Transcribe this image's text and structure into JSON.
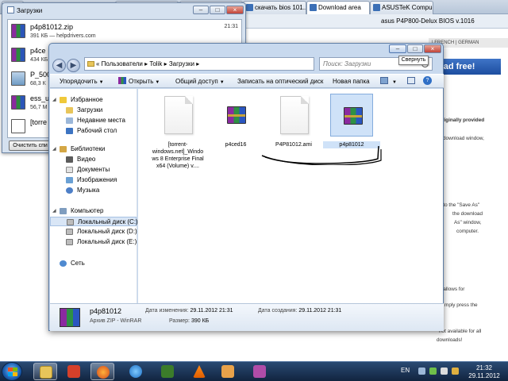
{
  "browser": {
    "tabs": [
      {
        "label": "Загрузки"
      },
      {
        "label": ""
      },
      {
        "label": ""
      },
      {
        "label": "скачать bios 101..."
      },
      {
        "label": "Download area"
      },
      {
        "label": "ASUSTeK Compu..."
      }
    ],
    "address": "asus P4P800-Delux BIOS v.1016",
    "site": {
      "strip": "| FRENCH | GERMAN",
      "banner": "oad free!",
      "lines": [
        {
          "text": "originally provided",
          "bold": true
        },
        {
          "text": "download window,",
          "bold": false
        },
        {
          "text": "n to the \"Save As\"",
          "bold": false
        },
        {
          "text": "the download",
          "bold": false
        },
        {
          "text": "As\" window,",
          "bold": false
        },
        {
          "text": "computer.",
          "bold": false
        },
        {
          "text": "n allows for",
          "bold": false
        },
        {
          "text": "mply press the",
          "bold": false
        },
        {
          "text": "not available for all",
          "bold": false
        },
        {
          "text": "downloads!",
          "bold": false
        }
      ]
    }
  },
  "downloads_window": {
    "title": "Загрузки",
    "items": [
      {
        "name": "p4p81012.zip",
        "size": "391 КБ — helpdrivers.com",
        "time": "21:31",
        "icon": "rar-icon"
      },
      {
        "name": "p4ce",
        "size": "434 КБ",
        "time": "",
        "icon": "rar-icon"
      },
      {
        "name": "P_500",
        "size": "68,3 К",
        "time": "",
        "icon": "image-icon"
      },
      {
        "name": "ess_u",
        "size": "56,7 М",
        "time": "",
        "icon": "rar-icon"
      },
      {
        "name": "[torre",
        "size": "",
        "time": "",
        "icon": "document-icon"
      }
    ],
    "clear_button": "Очистить спи"
  },
  "explorer": {
    "breadcrumb": "« Пользователи ▸ Tolik ▸ Загрузки ▸",
    "search_placeholder": "Поиск: Загрузки",
    "toolbar": {
      "organize": "Упорядочить",
      "open": "Открыть",
      "share": "Общий доступ",
      "burn": "Записать на оптический диск",
      "new_folder": "Новая папка"
    },
    "nav": {
      "favorites": "Избранное",
      "downloads": "Загрузки",
      "recent": "Недавние места",
      "desktop": "Рабочий стол",
      "libraries": "Библиотеки",
      "video": "Видео",
      "documents": "Документы",
      "images": "Изображения",
      "music": "Музыка",
      "computer": "Компьютер",
      "disk_c": "Локальный диск (C:)",
      "disk_d": "Локальный диск (D:)",
      "disk_e": "Локальный диск (E:)",
      "network": "Сеть"
    },
    "files": [
      {
        "name": "[torrent-windows.net]_Windows 8 Enterprise Final x64 (Volume) v....",
        "type": "document"
      },
      {
        "name": "p4ced16",
        "type": "rar"
      },
      {
        "name": "P4P81012.ami",
        "type": "document"
      },
      {
        "name": "p4p81012",
        "type": "rar"
      }
    ],
    "details": {
      "name": "p4p81012",
      "type": "Архив ZIP - WinRAR",
      "modified_label": "Дата изменения:",
      "modified": "29.11.2012 21:31",
      "size_label": "Размер:",
      "size": "390 КБ",
      "created_label": "Дата создания:",
      "created": "29.11.2012 21:31"
    },
    "tooltip": "Свернуть"
  },
  "taskbar": {
    "lang": "EN",
    "time": "21:32",
    "date": "29.11.2012"
  }
}
